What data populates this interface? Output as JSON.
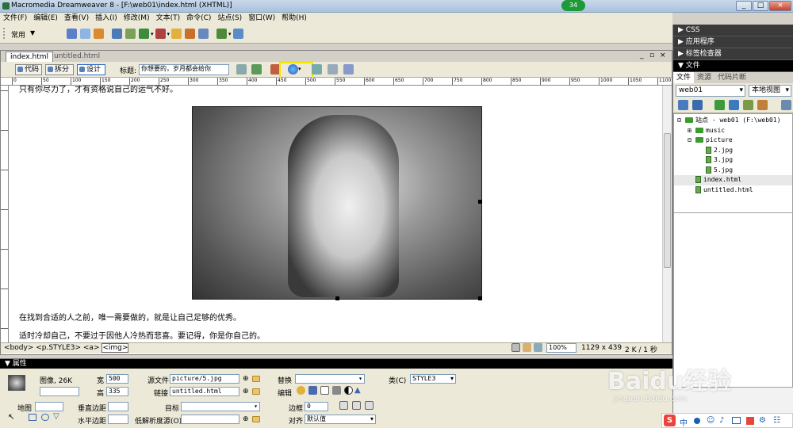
{
  "window": {
    "title": "Macromedia Dreamweaver 8 - [F:\\web01\\index.html (XHTML)]",
    "notification_count": "34",
    "controls": [
      "_",
      "□",
      "×"
    ]
  },
  "menu": [
    "文件(F)",
    "编辑(E)",
    "查看(V)",
    "插入(I)",
    "修改(M)",
    "文本(T)",
    "命令(C)",
    "站点(S)",
    "窗口(W)",
    "帮助(H)"
  ],
  "insert_bar": {
    "category": "常用"
  },
  "document": {
    "tabs": [
      "index.html",
      "untitled.html"
    ],
    "window_controls": [
      "_",
      "▫",
      "×"
    ],
    "view_buttons": [
      "代码",
      "拆分",
      "设计"
    ],
    "title_label": "标题:",
    "title_value": "你想要的，岁月都会给你",
    "ruler_ticks": [
      "0",
      "50",
      "100",
      "150",
      "200",
      "250",
      "300",
      "350",
      "400",
      "450",
      "500",
      "550",
      "600",
      "650",
      "700",
      "750",
      "800",
      "850",
      "900",
      "950",
      "1000",
      "1050",
      "1100"
    ],
    "paragraphs": [
      "只有你尽力了，才有资格说自己的运气不好。",
      "在找到合适的人之前，唯一需要做的，就是让自己足够的优秀。",
      "适时冷却自己，不要过于因他人冷热而悲喜。要记得，你是你自己的。"
    ],
    "tag_path": [
      "<body>",
      "<p.STYLE3>",
      "<a>",
      "<img>"
    ],
    "zoom": "100%",
    "dimensions": "1129 x 439",
    "size_time": "2 K / 1 秒"
  },
  "panels": {
    "collapsed": [
      "CSS",
      "应用程序",
      "标签检查器"
    ],
    "files_header": "文件",
    "tabs": [
      "文件",
      "资源",
      "代码片断"
    ],
    "site_select": "web01",
    "view_select": "本地视图",
    "tree": [
      {
        "label": "站点 - web01 (F:\\web01)",
        "kind": "folder",
        "level": 0,
        "expander": "⊟"
      },
      {
        "label": "music",
        "kind": "folder",
        "level": 1,
        "expander": "⊞"
      },
      {
        "label": "picture",
        "kind": "folder",
        "level": 1,
        "expander": "⊟"
      },
      {
        "label": "2.jpg",
        "kind": "file",
        "level": 2,
        "expander": ""
      },
      {
        "label": "3.jpg",
        "kind": "file",
        "level": 2,
        "expander": ""
      },
      {
        "label": "5.jpg",
        "kind": "file",
        "level": 2,
        "expander": ""
      },
      {
        "label": "index.html",
        "kind": "file",
        "level": 1,
        "expander": ""
      },
      {
        "label": "untitled.html",
        "kind": "file",
        "level": 1,
        "expander": ""
      }
    ]
  },
  "properties": {
    "header": "属性",
    "image_label": "图像, 26K",
    "width_label": "宽",
    "width": "500",
    "height_label": "高",
    "height": "335",
    "src_label": "源文件",
    "src": "picture/5.jpg",
    "link_label": "链接",
    "link": "untitled.html",
    "alt_label": "替换",
    "edit_label": "编辑",
    "class_label": "类(C)",
    "class_value": "STYLE3",
    "map_label": "地图",
    "vspace_label": "垂直边距",
    "hspace_label": "水平边距",
    "target_label": "目标",
    "lowsrc_label": "低解析度源(O)",
    "border_label": "边框",
    "border": "0",
    "align_label": "对齐",
    "align_value": "默认值"
  },
  "watermark": {
    "text": "Baidu经验",
    "url": "jingyan.baidu.com"
  },
  "ime_toolbar": {
    "label": "中"
  }
}
